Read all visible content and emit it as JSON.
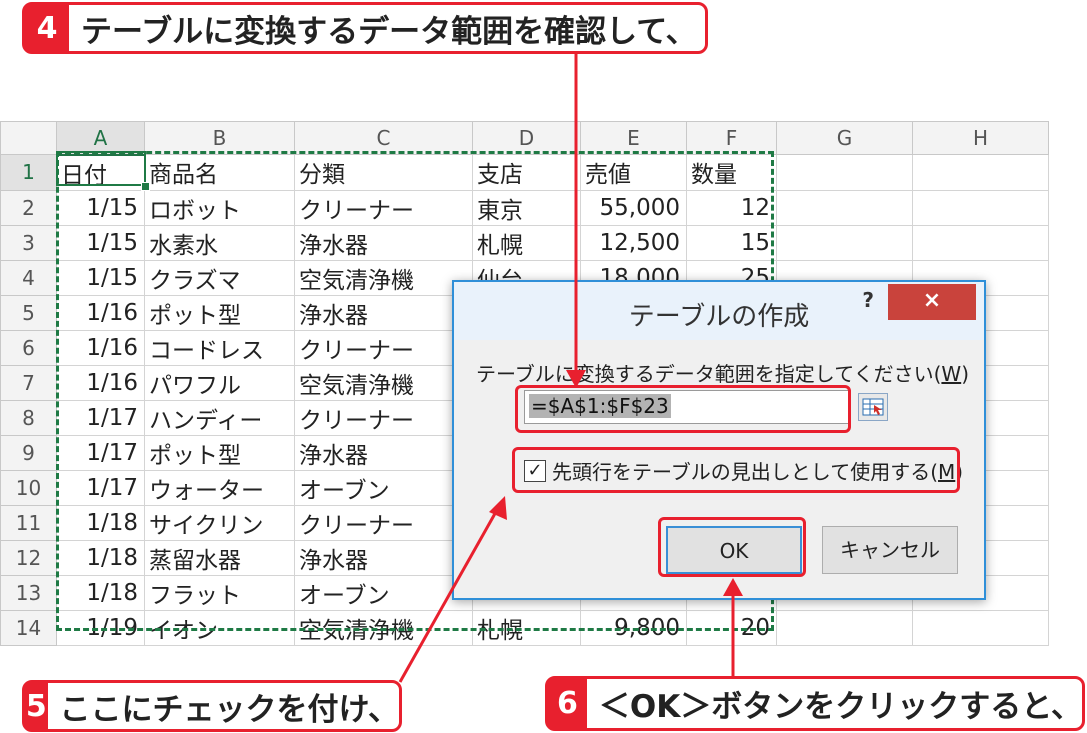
{
  "callouts": {
    "step4": {
      "num": "4",
      "text": "テーブルに変換するデータ範囲を確認して、"
    },
    "step5": {
      "num": "5",
      "text": "ここにチェックを付け、"
    },
    "step6": {
      "num": "6",
      "text": "＜OK＞ボタンをクリックすると、"
    }
  },
  "sheet": {
    "columns": [
      "A",
      "B",
      "C",
      "D",
      "E",
      "F",
      "G",
      "H"
    ],
    "rows": [
      {
        "n": "1",
        "a": "日付",
        "b": "商品名",
        "c": "分類",
        "d": "支店",
        "e": "売値",
        "f": "数量"
      },
      {
        "n": "2",
        "a": "1/15",
        "b": "ロボット",
        "c": "クリーナー",
        "d": "東京",
        "e": "55,000",
        "f": "12"
      },
      {
        "n": "3",
        "a": "1/15",
        "b": "水素水",
        "c": "浄水器",
        "d": "札幌",
        "e": "12,500",
        "f": "15"
      },
      {
        "n": "4",
        "a": "1/15",
        "b": "クラズマ",
        "c": "空気清浄機",
        "d": "仙台",
        "e": "18,000",
        "f": "25"
      },
      {
        "n": "5",
        "a": "1/16",
        "b": "ポット型",
        "c": "浄水器",
        "d": "",
        "e": "",
        "f": ""
      },
      {
        "n": "6",
        "a": "1/16",
        "b": "コードレス",
        "c": "クリーナー",
        "d": "",
        "e": "",
        "f": ""
      },
      {
        "n": "7",
        "a": "1/16",
        "b": "パワフル",
        "c": "空気清浄機",
        "d": "",
        "e": "",
        "f": ""
      },
      {
        "n": "8",
        "a": "1/17",
        "b": "ハンディー",
        "c": "クリーナー",
        "d": "",
        "e": "",
        "f": ""
      },
      {
        "n": "9",
        "a": "1/17",
        "b": "ポット型",
        "c": "浄水器",
        "d": "",
        "e": "",
        "f": ""
      },
      {
        "n": "10",
        "a": "1/17",
        "b": "ウォーター",
        "c": "オーブン",
        "d": "",
        "e": "",
        "f": ""
      },
      {
        "n": "11",
        "a": "1/18",
        "b": "サイクリン",
        "c": "クリーナー",
        "d": "",
        "e": "",
        "f": ""
      },
      {
        "n": "12",
        "a": "1/18",
        "b": "蒸留水器",
        "c": "浄水器",
        "d": "",
        "e": "",
        "f": ""
      },
      {
        "n": "13",
        "a": "1/18",
        "b": "フラット",
        "c": "オーブン",
        "d": "",
        "e": "",
        "f": ""
      },
      {
        "n": "14",
        "a": "1/19",
        "b": "イオン",
        "c": "空気清浄機",
        "d": "札幌",
        "e": "9,800",
        "f": "20"
      }
    ]
  },
  "dialog": {
    "title": "テーブルの作成",
    "help": "?",
    "close": "×",
    "prompt_before": "テーブルに変換するデータ範囲を指定してください(",
    "prompt_key": "W",
    "prompt_after": ")",
    "range_value": "=$A$1:$F$23",
    "picker_icon": "range-picker-icon",
    "checkbox_checked": true,
    "checkbox_mark": "✓",
    "check_before": "先頭行をテーブルの見出しとして使用する(",
    "check_key": "M",
    "check_after": ")",
    "ok_label": "OK",
    "cancel_label": "キャンセル"
  },
  "colors": {
    "accent_red": "#e8202e",
    "excel_green": "#1f7a45",
    "dialog_border": "#2f8fd8",
    "close_red": "#c9433c"
  }
}
